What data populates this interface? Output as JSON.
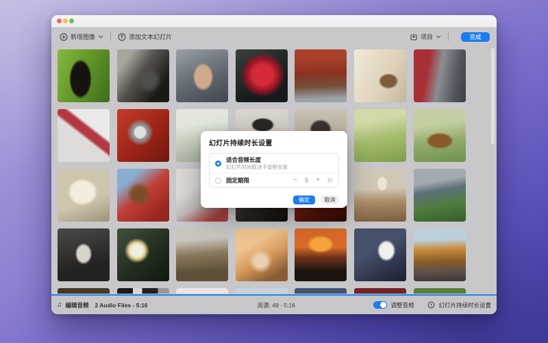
{
  "colors": {
    "accent": "#1c7df0",
    "timeline_blue": "#1e87f0"
  },
  "toolbar": {
    "add_image_label": "新增图像",
    "add_text_slide_label": "添加文本幻灯片",
    "project_label": "项目",
    "done_label": "完成"
  },
  "modal": {
    "title": "幻灯片持续时长设置",
    "fit_audio_label": "适合音频长度",
    "fit_audio_desc": "幻灯片时间取决于音频长度",
    "fit_audio_selected": true,
    "fixed_label": "固定期限",
    "fixed_selected": false,
    "stepper": {
      "minus": "−",
      "value": "5",
      "plus": "+",
      "unit": "秒"
    },
    "confirm_label": "确定",
    "cancel_label": "取消"
  },
  "bottom_bar": {
    "edit_audio_label": "编辑音频",
    "audio_files_info": "2 Audio Files - 5:16",
    "slides_info": "房源: 49 - 5:16",
    "adjust_audio_label": "调整音频",
    "adjust_audio_on": true,
    "duration_settings_label": "幻灯片持续时长设置"
  },
  "grid": {
    "photos": [
      {
        "name": "guitar-on-grass",
        "bg": "radial-gradient(ellipse 30% 52% at 44% 56%, #16130f 0 60%, rgba(22,19,15,0) 72%), linear-gradient(115deg,#86b83e,#5e9127 55%,#3f6b1a)"
      },
      {
        "name": "vintage-camera",
        "bg": "radial-gradient(circle at 60% 58%, #504e4a 0 16%, rgba(80,78,74,0) 30%), linear-gradient(125deg,#a8a49e 0 18%,#55524e 45%,#1b1916 80%)"
      },
      {
        "name": "holding-hands",
        "bg": "radial-gradient(ellipse 28% 38% at 52% 52%, #cfa98c 0 55%, rgba(207,169,140,0) 70%), linear-gradient(155deg,#9aa0a8,#626870 55%,#41464e)"
      },
      {
        "name": "red-rose",
        "bg": "radial-gradient(circle at 52% 48%, #d42a38 0 26%, #931527 42%, rgba(60,20,25,0) 58%), linear-gradient(150deg,#37413c,#161a1c 70%)"
      },
      {
        "name": "red-pavilion",
        "bg": "linear-gradient(178deg,#a8402c 0 18%,#8c3120 45%,#74503c 70%,#9aa3a6 92%)"
      },
      {
        "name": "writing-hand",
        "bg": "radial-gradient(ellipse 26% 20% at 66% 60%, #7c5c3c 0 55%, rgba(124,92,60,0) 75%), linear-gradient(115deg,#f0ead9,#ded2ba 60%,#c3b79e)"
      },
      {
        "name": "champagne-toast",
        "bg": "linear-gradient(100deg,#a82f36 0 28%,#8a8d92 50%,#54575e 78%,#3a3d44)"
      },
      {
        "name": "red-ribbon-gift",
        "bg": "linear-gradient(38deg,#dedcdb 0 48%,#b23944 52% 62%,#ebe9e8 66%)"
      },
      {
        "name": "red-car-headlight",
        "bg": "radial-gradient(circle at 44% 44%, #e0e0de 0 13%, #8f8f8d 17% 20%, rgba(143,143,141,0) 32%), linear-gradient(135deg,#c53b2c,#9c2416 55%,#6f170e)"
      },
      {
        "name": "misty-mountains",
        "bg": "linear-gradient(172deg,#e2e6dc 0 30%,#c4ccba 60%,#a3ae9c)"
      },
      {
        "name": "man-with-hat",
        "bg": "radial-gradient(ellipse 30% 18% at 52% 30%, #2a2624 0 60%, rgba(42,38,36,0) 75%), linear-gradient(180deg,#dad6cf,#bdb6ab)"
      },
      {
        "name": "shaded-portrait",
        "bg": "radial-gradient(ellipse 30% 26% at 50% 38%, #3b332c 0 55%, rgba(59,51,44,0) 72%), linear-gradient(180deg,#c9c2b4,#a79e8d)"
      },
      {
        "name": "wheat-field",
        "bg": "linear-gradient(168deg,#d2d8a6 0 25%,#a6bd6e 55%,#7e9e4c)"
      },
      {
        "name": "leather-satchel",
        "bg": "radial-gradient(ellipse 34% 20% at 50% 60%, #8a5a2c 0 60%, rgba(138,90,44,0) 78%), linear-gradient(172deg,#c2cfa2 0 30%,#93ac6c 60%,#6f9150)"
      },
      {
        "name": "open-notebook",
        "bg": "radial-gradient(ellipse 40% 36% at 48% 44%, #f2ecdc 0 55%, rgba(242,236,220,0) 72%), linear-gradient(160deg,#cdc5ae 0 60%,#9b9378)"
      },
      {
        "name": "football-player",
        "bg": "radial-gradient(circle at 42% 48%, #7c4e28 0 16%, rgba(124,78,40,0) 30%), linear-gradient(140deg,#88add0 0 22%,#c23f36 48%,#96261f 85%)"
      },
      {
        "name": "red-dancers",
        "bg": "linear-gradient(150deg,#dbd8d6 0 35%,#bcb8b6 60%,#a84040 85%)"
      },
      {
        "name": "dark-interior",
        "bg": "linear-gradient(140deg,#4e4a44 0 25%,#26221e 60%,#100e0c)"
      },
      {
        "name": "red-texture",
        "bg": "linear-gradient(145deg,#83291f 0 30%,#541309 65%,#2c0a05)"
      },
      {
        "name": "desert-jumper",
        "bg": "radial-gradient(ellipse 14% 20% at 54% 28%, #ece4d4 0 55%, rgba(236,228,212,0) 75%), linear-gradient(178deg,#cfc6b6 0 38%,#a98d66 62%,#7c5e40)"
      },
      {
        "name": "harvest-hands",
        "bg": "linear-gradient(170deg,#a4abb0 0 26%,#5d7078 42%,#4f7d3e 68%,#355c2a)"
      },
      {
        "name": "camera-portrait",
        "bg": "radial-gradient(ellipse 24% 30% at 50% 48%, #d8d4cc 0 50%, rgba(216,212,204,0) 68%), linear-gradient(165deg,#4c4a48,#232220 70%)"
      },
      {
        "name": "water-lily",
        "bg": "radial-gradient(circle at 38% 42%, #f0ede2 0 14%, #e8d89a 16% 18%, rgba(240,237,226,0) 28%), linear-gradient(140deg,#42503c,#222d1f 55%,#121811)"
      },
      {
        "name": "dry-reeds",
        "bg": "linear-gradient(175deg,#c8c6bd 0 22%,#8a7a5e 48%,#5e4f38 80%)"
      },
      {
        "name": "phone-in-hands",
        "bg": "radial-gradient(circle at 48% 62%, #e8d0b0 0 14%, rgba(232,208,176,0) 28%), linear-gradient(150deg,#f0c490 0 30%,#d89c5c 55%,#8a5c34 85%)"
      },
      {
        "name": "sunset-silhouette",
        "bg": "radial-gradient(ellipse 40% 26% at 50% 30%, #f6a53c 0 45%, rgba(246,165,60,0) 65%), linear-gradient(180deg,#d86a28 0 35%,#6e3418 55%,#1c1410 80%)"
      },
      {
        "name": "reading-in-car",
        "bg": "radial-gradient(ellipse 26% 30% at 62% 42%, #f0efeb 0 50%, rgba(240,239,235,0) 68%), linear-gradient(150deg,#47506a 0 40%,#2c3248 75%,#1c2030)"
      },
      {
        "name": "autumn-road",
        "bg": "linear-gradient(178deg,#bcd0dc 0 22%,#c78a3c 40%,#8a5c28 62%,#5e5148 80%,#3c3834)"
      },
      {
        "name": "dark-scene-1",
        "bg": "linear-gradient(180deg,#4a3828,#2c2014)"
      },
      {
        "name": "striped-scene",
        "bg": "linear-gradient(90deg,#1a1a1a 0 30%,#d8d8d8 30% 48%,#222 48% 78%,#999 78%)"
      },
      {
        "name": "pale-blossom",
        "bg": "linear-gradient(180deg,#eee4e6,#d8c8cc)"
      },
      {
        "name": "pale-structure",
        "bg": "linear-gradient(180deg,#ccd4da,#b0bac2)"
      },
      {
        "name": "denim-scene",
        "bg": "linear-gradient(180deg,#46546e,#2e3a50)"
      },
      {
        "name": "dark-red-scene",
        "bg": "linear-gradient(180deg,#76242c,#4c141a)"
      },
      {
        "name": "green-figures",
        "bg": "linear-gradient(180deg,#5d8040,#3f6029)"
      }
    ]
  }
}
